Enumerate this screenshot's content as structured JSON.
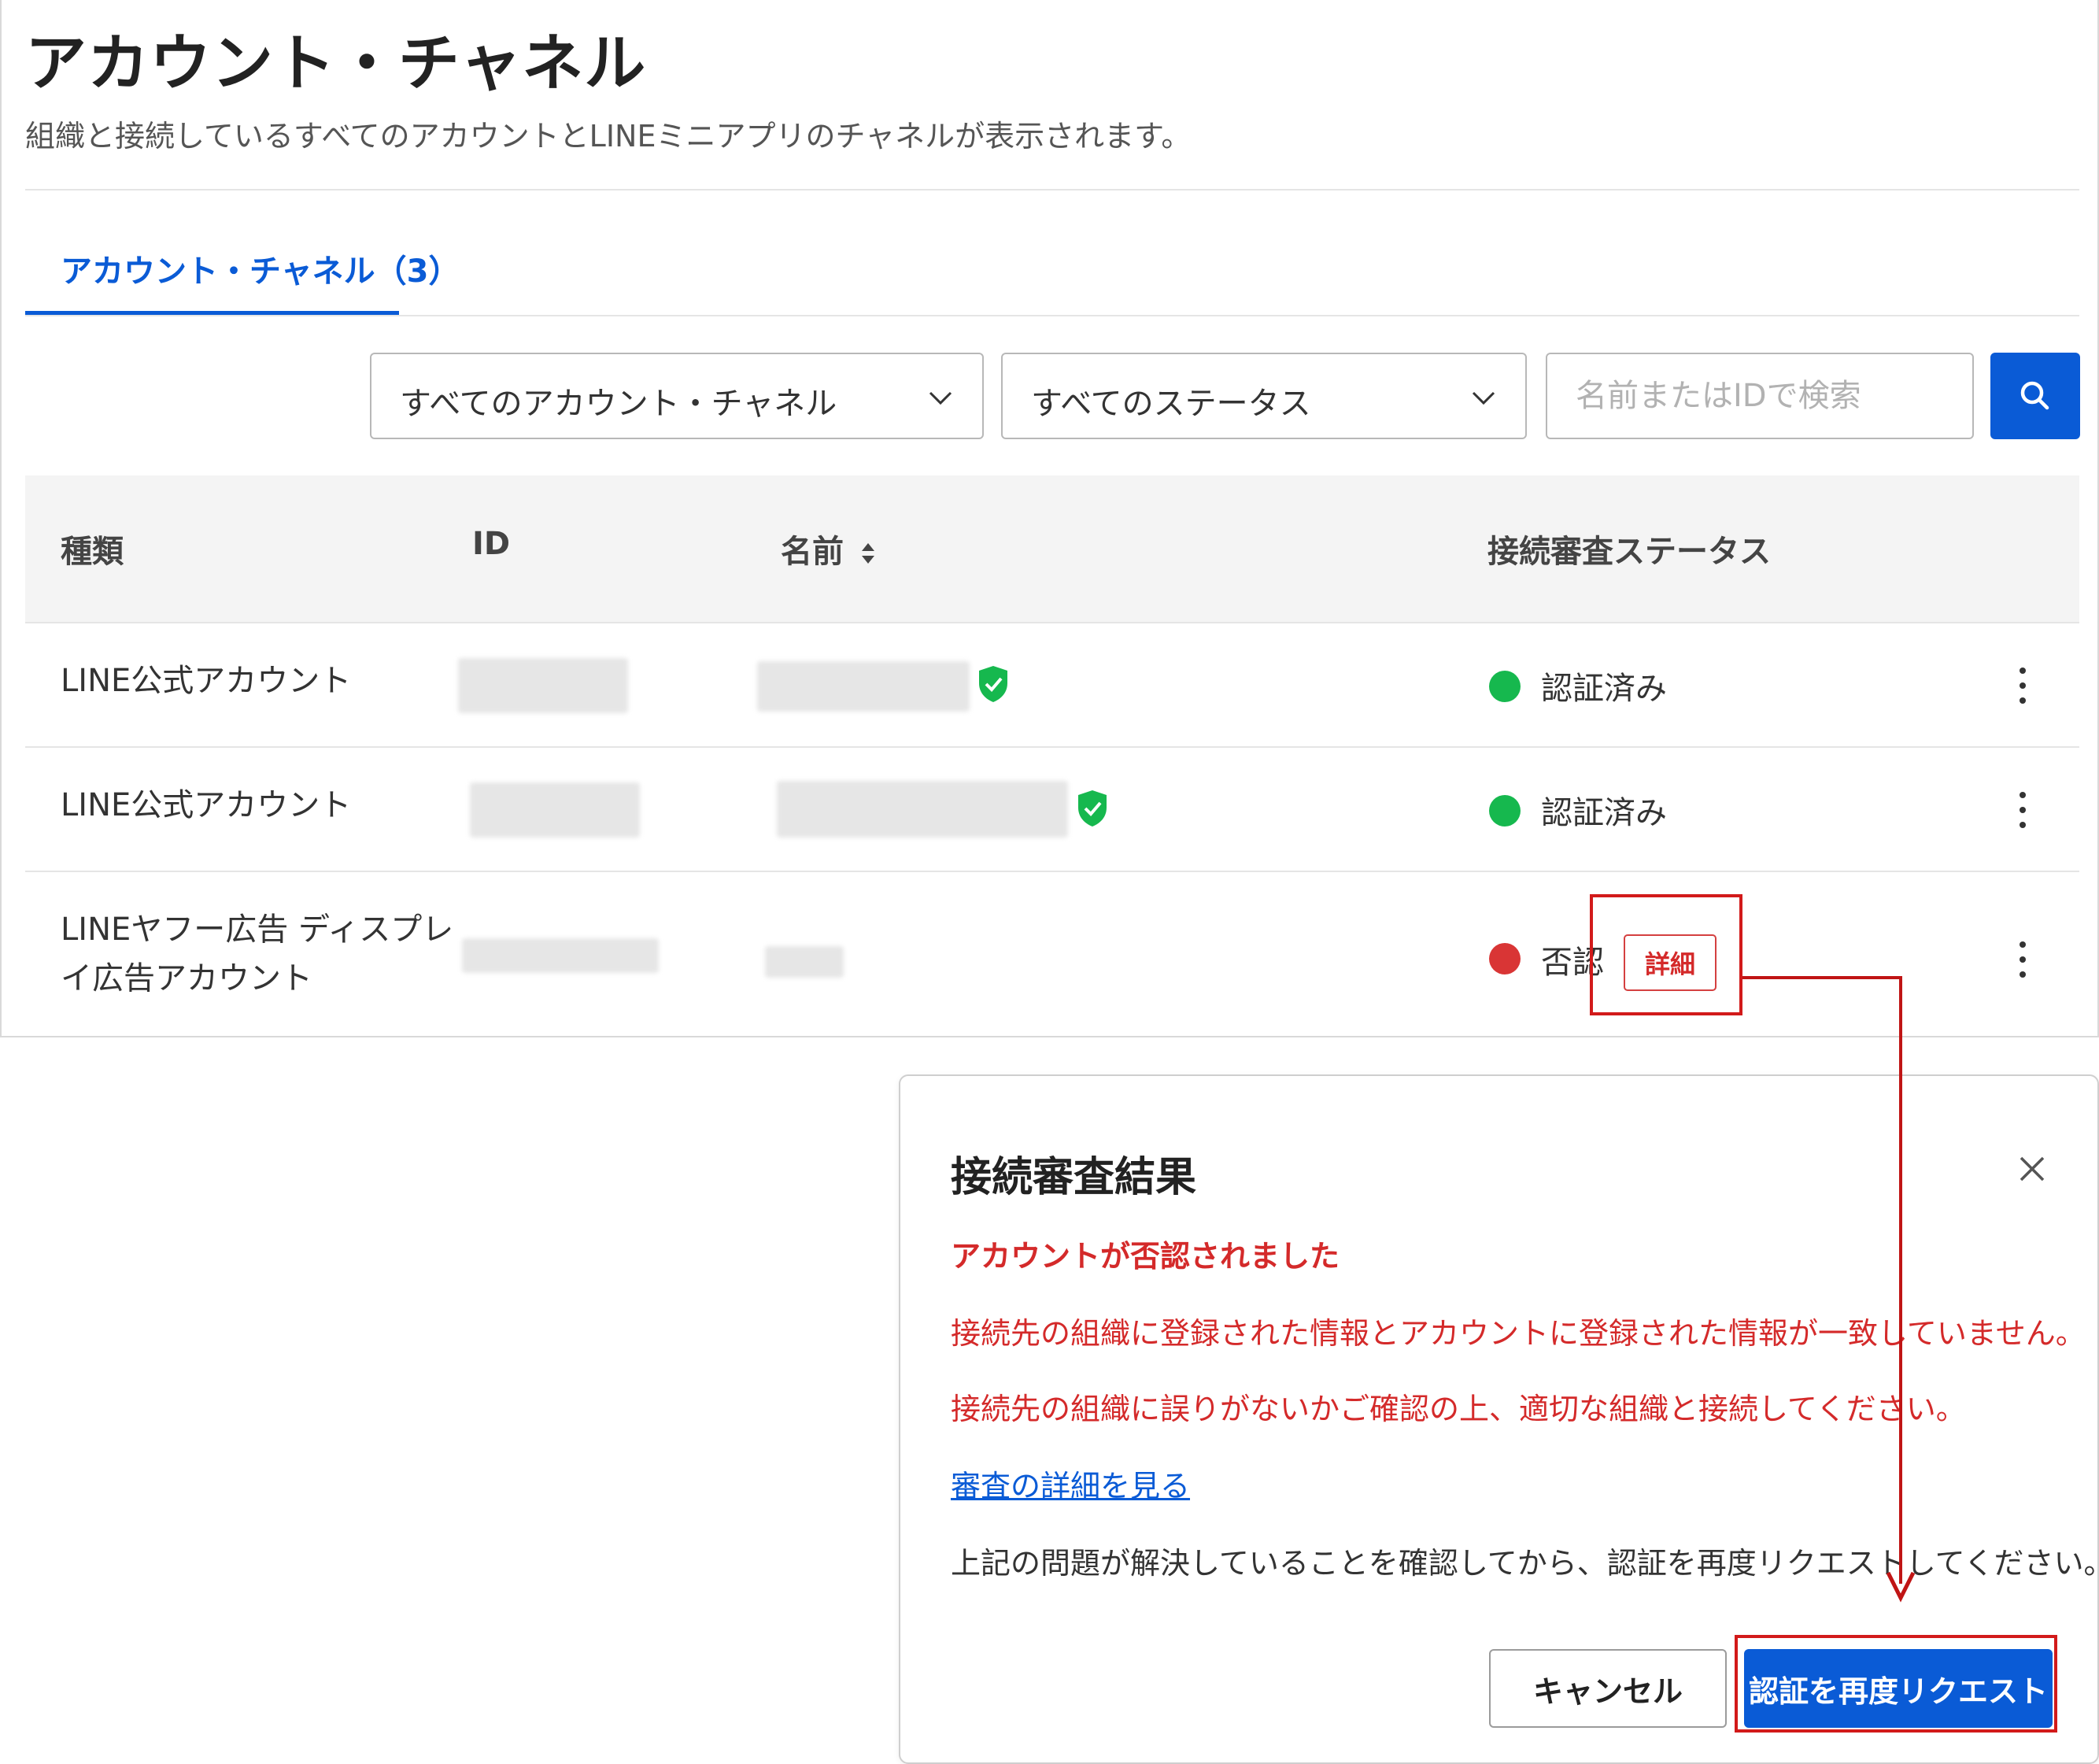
{
  "page": {
    "title": "アカウント・チャネル",
    "description": "組織と接続しているすべてのアカウントとLINEミニアプリのチャネルが表示されます。"
  },
  "tabs": [
    {
      "label": "アカウント・チャネル（3）",
      "active": true
    }
  ],
  "filters": {
    "type_select": "すべてのアカウント・チャネル",
    "status_select": "すべてのステータス",
    "search_placeholder": "名前またはIDで検索"
  },
  "table": {
    "headers": [
      "種類",
      "ID",
      "名前",
      "接続審査ステータス"
    ],
    "rows": [
      {
        "type": "LINE公式アカウント",
        "verified_badge": true,
        "status": "認証済み",
        "status_color": "#16b84e"
      },
      {
        "type": "LINE公式アカウント",
        "verified_badge": true,
        "status": "認証済み",
        "status_color": "#16b84e"
      },
      {
        "type_line1": "LINEヤフー広告 ディスプレ",
        "type_line2": "イ広告アカウント",
        "verified_badge": false,
        "status": "否認",
        "status_color": "#d93535",
        "detail_label": "詳細"
      }
    ]
  },
  "modal": {
    "title": "接続審査結果",
    "rejected_heading": "アカウントが否認されました",
    "message_1": "接続先の組織に登録された情報とアカウントに登録された情報が一致していません。",
    "message_2": "接続先の組織に誤りがないかご確認の上、適切な組織と接続してください。",
    "link": "審査の詳細を見る",
    "note": "上記の問題が解決していることを確認してから、認証を再度リクエストしてください。",
    "cancel_label": "キャンセル",
    "reauth_label": "認証を再度リクエスト"
  },
  "colors": {
    "accent": "#0a5bd6",
    "error": "#d42a2a",
    "success": "#16b84e",
    "annotation": "#d21a1a"
  },
  "icons": [
    "chevron-down-icon",
    "search-icon",
    "sort-icon",
    "shield-check-icon",
    "more-vertical-icon",
    "close-icon"
  ]
}
